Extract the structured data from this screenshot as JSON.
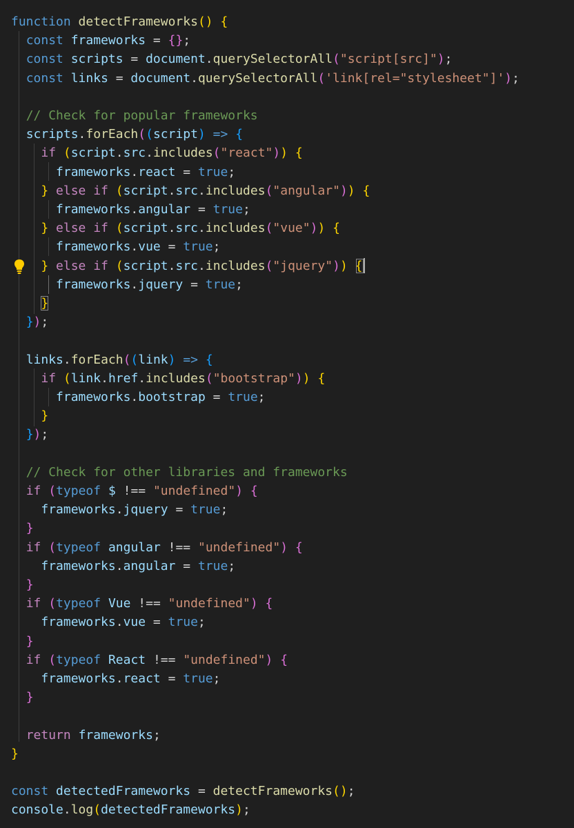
{
  "theme": {
    "background": "#1f1f1f",
    "keyword": "#569cd6",
    "control": "#c586c0",
    "function": "#dcdcaa",
    "variable": "#9cdcfe",
    "string": "#ce9178",
    "comment": "#6a9955",
    "plain": "#d4d4d4",
    "bracket_level_1": "#ffd700",
    "bracket_level_2": "#da70d6",
    "bracket_level_3": "#179fff",
    "lightbulb": "#ffcc00"
  },
  "code": {
    "lines": [
      [
        [
          "function",
          "kw"
        ],
        [
          " "
        ],
        [
          "detectFrameworks",
          "fn"
        ],
        [
          "()",
          "b1"
        ],
        [
          " "
        ],
        [
          "{",
          "b1"
        ]
      ],
      [
        [
          "  "
        ],
        [
          "const",
          "kw"
        ],
        [
          " "
        ],
        [
          "frameworks",
          "var"
        ],
        [
          " = "
        ],
        [
          "{}",
          "b2"
        ],
        [
          ";"
        ]
      ],
      [
        [
          "  "
        ],
        [
          "const",
          "kw"
        ],
        [
          " "
        ],
        [
          "scripts",
          "var"
        ],
        [
          " = "
        ],
        [
          "document",
          "var"
        ],
        [
          "."
        ],
        [
          "querySelectorAll",
          "fn"
        ],
        [
          "(",
          "b2"
        ],
        [
          "\"script[src]\"",
          "str"
        ],
        [
          ")",
          "b2"
        ],
        [
          ";"
        ]
      ],
      [
        [
          "  "
        ],
        [
          "const",
          "kw"
        ],
        [
          " "
        ],
        [
          "links",
          "var"
        ],
        [
          " = "
        ],
        [
          "document",
          "var"
        ],
        [
          "."
        ],
        [
          "querySelectorAll",
          "fn"
        ],
        [
          "(",
          "b2"
        ],
        [
          "'link[rel=\"stylesheet\"]'",
          "str"
        ],
        [
          ")",
          "b2"
        ],
        [
          ";"
        ]
      ],
      [],
      [
        [
          "  "
        ],
        [
          "// Check for popular frameworks",
          "cmt"
        ]
      ],
      [
        [
          "  "
        ],
        [
          "scripts",
          "var"
        ],
        [
          "."
        ],
        [
          "forEach",
          "fn"
        ],
        [
          "(",
          "b2"
        ],
        [
          "(",
          "b3"
        ],
        [
          "script",
          "var"
        ],
        [
          ")",
          "b3"
        ],
        [
          " "
        ],
        [
          "=>",
          "kw"
        ],
        [
          " "
        ],
        [
          "{",
          "b3"
        ]
      ],
      [
        [
          "    "
        ],
        [
          "if",
          "ctl"
        ],
        [
          " "
        ],
        [
          "(",
          "b1"
        ],
        [
          "script",
          "var"
        ],
        [
          "."
        ],
        [
          "src",
          "var"
        ],
        [
          "."
        ],
        [
          "includes",
          "fn"
        ],
        [
          "(",
          "b2"
        ],
        [
          "\"react\"",
          "str"
        ],
        [
          ")",
          "b2"
        ],
        [
          ")",
          "b1"
        ],
        [
          " "
        ],
        [
          "{",
          "b1"
        ]
      ],
      [
        [
          "      "
        ],
        [
          "frameworks",
          "var"
        ],
        [
          "."
        ],
        [
          "react",
          "var"
        ],
        [
          " = "
        ],
        [
          "true",
          "kw"
        ],
        [
          ";"
        ]
      ],
      [
        [
          "    "
        ],
        [
          "}",
          "b1"
        ],
        [
          " "
        ],
        [
          "else",
          "ctl"
        ],
        [
          " "
        ],
        [
          "if",
          "ctl"
        ],
        [
          " "
        ],
        [
          "(",
          "b1"
        ],
        [
          "script",
          "var"
        ],
        [
          "."
        ],
        [
          "src",
          "var"
        ],
        [
          "."
        ],
        [
          "includes",
          "fn"
        ],
        [
          "(",
          "b2"
        ],
        [
          "\"angular\"",
          "str"
        ],
        [
          ")",
          "b2"
        ],
        [
          ")",
          "b1"
        ],
        [
          " "
        ],
        [
          "{",
          "b1"
        ]
      ],
      [
        [
          "      "
        ],
        [
          "frameworks",
          "var"
        ],
        [
          "."
        ],
        [
          "angular",
          "var"
        ],
        [
          " = "
        ],
        [
          "true",
          "kw"
        ],
        [
          ";"
        ]
      ],
      [
        [
          "    "
        ],
        [
          "}",
          "b1"
        ],
        [
          " "
        ],
        [
          "else",
          "ctl"
        ],
        [
          " "
        ],
        [
          "if",
          "ctl"
        ],
        [
          " "
        ],
        [
          "(",
          "b1"
        ],
        [
          "script",
          "var"
        ],
        [
          "."
        ],
        [
          "src",
          "var"
        ],
        [
          "."
        ],
        [
          "includes",
          "fn"
        ],
        [
          "(",
          "b2"
        ],
        [
          "\"vue\"",
          "str"
        ],
        [
          ")",
          "b2"
        ],
        [
          ")",
          "b1"
        ],
        [
          " "
        ],
        [
          "{",
          "b1"
        ]
      ],
      [
        [
          "      "
        ],
        [
          "frameworks",
          "var"
        ],
        [
          "."
        ],
        [
          "vue",
          "var"
        ],
        [
          " = "
        ],
        [
          "true",
          "kw"
        ],
        [
          ";"
        ]
      ],
      [
        [
          "    "
        ],
        [
          "}",
          "b1"
        ],
        [
          " "
        ],
        [
          "else",
          "ctl"
        ],
        [
          " "
        ],
        [
          "if",
          "ctl"
        ],
        [
          " "
        ],
        [
          "(",
          "b1"
        ],
        [
          "script",
          "var"
        ],
        [
          "."
        ],
        [
          "src",
          "var"
        ],
        [
          "."
        ],
        [
          "includes",
          "fn"
        ],
        [
          "(",
          "b2"
        ],
        [
          "\"jquery\"",
          "str"
        ],
        [
          ")",
          "b2"
        ],
        [
          ")",
          "b1"
        ],
        [
          " "
        ],
        [
          "{",
          "b1"
        ]
      ],
      [
        [
          "      "
        ],
        [
          "frameworks",
          "var"
        ],
        [
          "."
        ],
        [
          "jquery",
          "var"
        ],
        [
          " = "
        ],
        [
          "true",
          "kw"
        ],
        [
          ";"
        ]
      ],
      [
        [
          "    "
        ],
        [
          "}",
          "b1"
        ]
      ],
      [
        [
          "  "
        ],
        [
          "}",
          "b3"
        ],
        [
          ")",
          "b2"
        ],
        [
          ";"
        ]
      ],
      [],
      [
        [
          "  "
        ],
        [
          "links",
          "var"
        ],
        [
          "."
        ],
        [
          "forEach",
          "fn"
        ],
        [
          "(",
          "b2"
        ],
        [
          "(",
          "b3"
        ],
        [
          "link",
          "var"
        ],
        [
          ")",
          "b3"
        ],
        [
          " "
        ],
        [
          "=>",
          "kw"
        ],
        [
          " "
        ],
        [
          "{",
          "b3"
        ]
      ],
      [
        [
          "    "
        ],
        [
          "if",
          "ctl"
        ],
        [
          " "
        ],
        [
          "(",
          "b1"
        ],
        [
          "link",
          "var"
        ],
        [
          "."
        ],
        [
          "href",
          "var"
        ],
        [
          "."
        ],
        [
          "includes",
          "fn"
        ],
        [
          "(",
          "b2"
        ],
        [
          "\"bootstrap\"",
          "str"
        ],
        [
          ")",
          "b2"
        ],
        [
          ")",
          "b1"
        ],
        [
          " "
        ],
        [
          "{",
          "b1"
        ]
      ],
      [
        [
          "      "
        ],
        [
          "frameworks",
          "var"
        ],
        [
          "."
        ],
        [
          "bootstrap",
          "var"
        ],
        [
          " = "
        ],
        [
          "true",
          "kw"
        ],
        [
          ";"
        ]
      ],
      [
        [
          "    "
        ],
        [
          "}",
          "b1"
        ]
      ],
      [
        [
          "  "
        ],
        [
          "}",
          "b3"
        ],
        [
          ")",
          "b2"
        ],
        [
          ";"
        ]
      ],
      [],
      [
        [
          "  "
        ],
        [
          "// Check for other libraries and frameworks",
          "cmt"
        ]
      ],
      [
        [
          "  "
        ],
        [
          "if",
          "ctl"
        ],
        [
          " "
        ],
        [
          "(",
          "b2"
        ],
        [
          "typeof",
          "kw"
        ],
        [
          " "
        ],
        [
          "$",
          "var"
        ],
        [
          " !== "
        ],
        [
          "\"undefined\"",
          "str"
        ],
        [
          ")",
          "b2"
        ],
        [
          " "
        ],
        [
          "{",
          "b2"
        ]
      ],
      [
        [
          "    "
        ],
        [
          "frameworks",
          "var"
        ],
        [
          "."
        ],
        [
          "jquery",
          "var"
        ],
        [
          " = "
        ],
        [
          "true",
          "kw"
        ],
        [
          ";"
        ]
      ],
      [
        [
          "  "
        ],
        [
          "}",
          "b2"
        ]
      ],
      [
        [
          "  "
        ],
        [
          "if",
          "ctl"
        ],
        [
          " "
        ],
        [
          "(",
          "b2"
        ],
        [
          "typeof",
          "kw"
        ],
        [
          " "
        ],
        [
          "angular",
          "var"
        ],
        [
          " !== "
        ],
        [
          "\"undefined\"",
          "str"
        ],
        [
          ")",
          "b2"
        ],
        [
          " "
        ],
        [
          "{",
          "b2"
        ]
      ],
      [
        [
          "    "
        ],
        [
          "frameworks",
          "var"
        ],
        [
          "."
        ],
        [
          "angular",
          "var"
        ],
        [
          " = "
        ],
        [
          "true",
          "kw"
        ],
        [
          ";"
        ]
      ],
      [
        [
          "  "
        ],
        [
          "}",
          "b2"
        ]
      ],
      [
        [
          "  "
        ],
        [
          "if",
          "ctl"
        ],
        [
          " "
        ],
        [
          "(",
          "b2"
        ],
        [
          "typeof",
          "kw"
        ],
        [
          " "
        ],
        [
          "Vue",
          "var"
        ],
        [
          " !== "
        ],
        [
          "\"undefined\"",
          "str"
        ],
        [
          ")",
          "b2"
        ],
        [
          " "
        ],
        [
          "{",
          "b2"
        ]
      ],
      [
        [
          "    "
        ],
        [
          "frameworks",
          "var"
        ],
        [
          "."
        ],
        [
          "vue",
          "var"
        ],
        [
          " = "
        ],
        [
          "true",
          "kw"
        ],
        [
          ";"
        ]
      ],
      [
        [
          "  "
        ],
        [
          "}",
          "b2"
        ]
      ],
      [
        [
          "  "
        ],
        [
          "if",
          "ctl"
        ],
        [
          " "
        ],
        [
          "(",
          "b2"
        ],
        [
          "typeof",
          "kw"
        ],
        [
          " "
        ],
        [
          "React",
          "var"
        ],
        [
          " !== "
        ],
        [
          "\"undefined\"",
          "str"
        ],
        [
          ")",
          "b2"
        ],
        [
          " "
        ],
        [
          "{",
          "b2"
        ]
      ],
      [
        [
          "    "
        ],
        [
          "frameworks",
          "var"
        ],
        [
          "."
        ],
        [
          "react",
          "var"
        ],
        [
          " = "
        ],
        [
          "true",
          "kw"
        ],
        [
          ";"
        ]
      ],
      [
        [
          "  "
        ],
        [
          "}",
          "b2"
        ]
      ],
      [],
      [
        [
          "  "
        ],
        [
          "return",
          "ctl"
        ],
        [
          " "
        ],
        [
          "frameworks",
          "var"
        ],
        [
          ";"
        ]
      ],
      [
        [
          "}",
          "b1"
        ]
      ],
      [],
      [
        [
          "const",
          "kw"
        ],
        [
          " "
        ],
        [
          "detectedFrameworks",
          "var"
        ],
        [
          " = "
        ],
        [
          "detectFrameworks",
          "fn"
        ],
        [
          "()",
          "b1"
        ],
        [
          ";"
        ]
      ],
      [
        [
          "console",
          "var"
        ],
        [
          "."
        ],
        [
          "log",
          "fn"
        ],
        [
          "(",
          "b1"
        ],
        [
          "detectedFrameworks",
          "var"
        ],
        [
          ")",
          "b1"
        ],
        [
          ";"
        ]
      ]
    ]
  }
}
